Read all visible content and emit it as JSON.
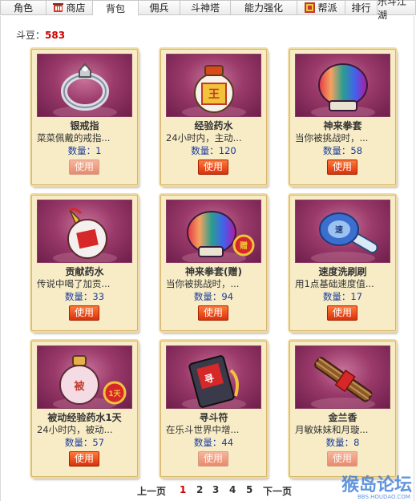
{
  "tabs": [
    {
      "label": "角色",
      "icon": ""
    },
    {
      "label": "商店",
      "icon": "shop-icon"
    },
    {
      "label": "背包",
      "icon": ""
    },
    {
      "label": "佣兵",
      "icon": ""
    },
    {
      "label": "斗神塔",
      "icon": ""
    },
    {
      "label": "能力强化",
      "icon": ""
    },
    {
      "label": "帮派",
      "icon": "clan-icon"
    },
    {
      "label": "排行",
      "icon": ""
    },
    {
      "label": "乐斗江湖",
      "icon": ""
    }
  ],
  "active_tab": "背包",
  "currency": {
    "label": "斗豆：",
    "value": "583"
  },
  "items": [
    {
      "name": "银戒指",
      "desc": "菜菜佩戴的戒指...",
      "qty_label": "数量：",
      "qty": "1",
      "button": "使用",
      "enabled": false,
      "icon": "silver-ring-icon"
    },
    {
      "name": "经验药水",
      "desc": "24小时内，主动...",
      "qty_label": "数量：",
      "qty": "120",
      "button": "使用",
      "enabled": true,
      "icon": "exp-potion-icon"
    },
    {
      "name": "神来拳套",
      "desc": "当你被挑战时，...",
      "qty_label": "数量：",
      "qty": "58",
      "button": "使用",
      "enabled": true,
      "icon": "rainbow-glove-icon"
    },
    {
      "name": "贡献药水",
      "desc": "传说中喝了加贡...",
      "qty_label": "数量：",
      "qty": "33",
      "button": "使用",
      "enabled": true,
      "icon": "contribution-potion-icon"
    },
    {
      "name": "神来拳套(赠)",
      "desc": "当你被挑战时，...",
      "qty_label": "数量：",
      "qty": "94",
      "button": "使用",
      "enabled": true,
      "icon": "rainbow-glove-gift-icon"
    },
    {
      "name": "速度洗刷刷",
      "desc": "用1点基础速度值...",
      "qty_label": "数量：",
      "qty": "17",
      "button": "使用",
      "enabled": true,
      "icon": "speed-brush-icon"
    },
    {
      "name": "被动经验药水1天",
      "desc": "24小时内，被动...",
      "qty_label": "数量：",
      "qty": "57",
      "button": "使用",
      "enabled": true,
      "icon": "passive-exp-potion-icon"
    },
    {
      "name": "寻斗符",
      "desc": "在乐斗世界中增...",
      "qty_label": "数量：",
      "qty": "44",
      "button": "使用",
      "enabled": false,
      "icon": "talisman-icon"
    },
    {
      "name": "金兰香",
      "desc": "月敏妹妹和月璇...",
      "qty_label": "数量：",
      "qty": "8",
      "button": "使用",
      "enabled": false,
      "icon": "incense-icon"
    }
  ],
  "pager": {
    "prev": "上一页",
    "pages": [
      "1",
      "2",
      "3",
      "4",
      "5"
    ],
    "current": "1",
    "next": "下一页"
  },
  "watermark": {
    "title": "猴岛论坛",
    "url": "BBS.HOUDAO.COM"
  },
  "colors": {
    "accent": "#cc0000",
    "qty_blue": "#1a3c9a",
    "button": "#d9310c",
    "card_bg": "#f7ecc6"
  }
}
